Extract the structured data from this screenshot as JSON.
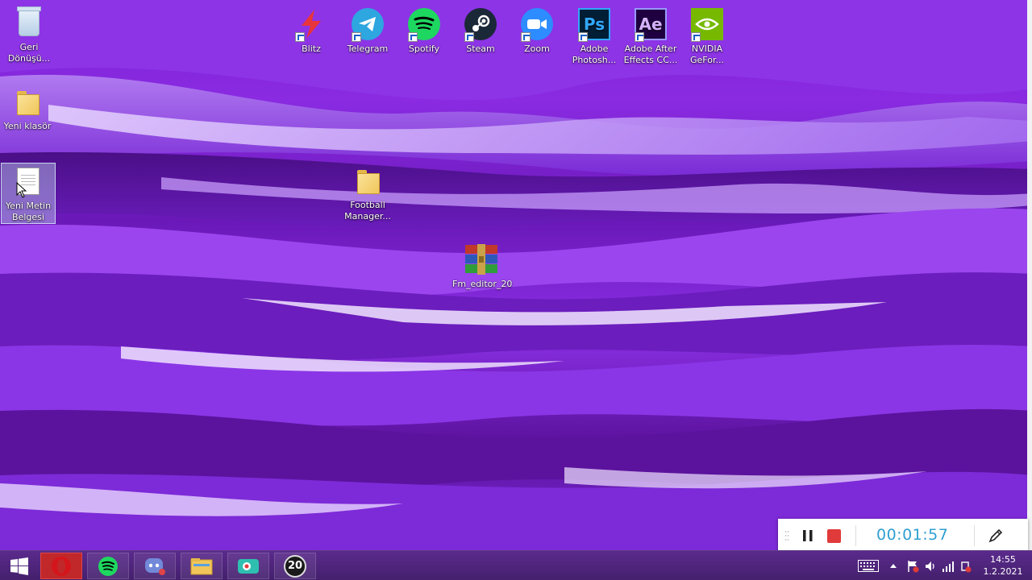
{
  "desktop": {
    "icons_left": [
      {
        "label": "Geri Dönüşü...",
        "icon": "recycle-bin-icon"
      },
      {
        "label": "Yeni klasör",
        "icon": "folder-icon"
      },
      {
        "label": "Yeni Metin Belgesi",
        "icon": "text-document-icon",
        "selected": true
      }
    ],
    "icons_top": [
      {
        "label": "Blitz",
        "icon": "blitz-icon",
        "color": "#e8353b"
      },
      {
        "label": "Telegram",
        "icon": "telegram-icon",
        "color": "#2ea6e0"
      },
      {
        "label": "Spotify",
        "icon": "spotify-icon",
        "color": "#1ed760"
      },
      {
        "label": "Steam",
        "icon": "steam-icon",
        "color": "#1b2838"
      },
      {
        "label": "Zoom",
        "icon": "zoom-icon",
        "color": "#2d8cff"
      },
      {
        "label": "Adobe Photosh...",
        "icon": "photoshop-icon",
        "color": "#001e36",
        "mark": "Ps"
      },
      {
        "label": "Adobe After Effects CC...",
        "icon": "after-effects-icon",
        "color": "#1f0040",
        "mark": "Ae"
      },
      {
        "label": "NVIDIA GeFor...",
        "icon": "nvidia-icon",
        "color": "#76b900"
      }
    ],
    "icons_middle": [
      {
        "label": "Football Manager...",
        "icon": "folder-icon"
      },
      {
        "label": "Fm_editor_20",
        "icon": "winrar-archive-icon"
      }
    ]
  },
  "taskbar": {
    "items": [
      {
        "name": "start-button",
        "icon": "windows-icon"
      },
      {
        "name": "opera",
        "icon": "opera-icon",
        "color": "#d4161c"
      },
      {
        "name": "spotify",
        "icon": "spotify-icon",
        "color": "#1ed760"
      },
      {
        "name": "discord",
        "icon": "discord-icon",
        "color": "#7289da"
      },
      {
        "name": "file-explorer",
        "icon": "file-explorer-icon",
        "color": "#f0c65a"
      },
      {
        "name": "screen-recorder",
        "icon": "recorder-icon",
        "color": "#2ebfb0"
      },
      {
        "name": "football-manager-20",
        "icon": "fm20-icon",
        "mark": "20"
      }
    ],
    "clock": {
      "time": "14:55",
      "date": "1.2.2021"
    }
  },
  "recorder": {
    "timer": "00:01:57",
    "accent": "#2f9fd1",
    "stop_color": "#e03a3a"
  }
}
